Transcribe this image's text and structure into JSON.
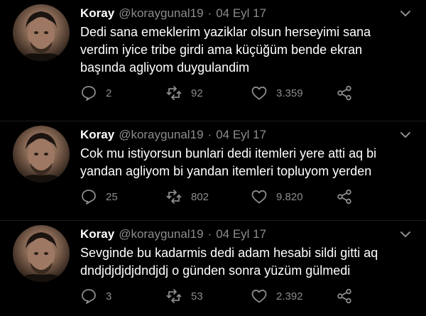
{
  "tweets": [
    {
      "name": "Koray",
      "handle": "@koraygunal19",
      "separator": "·",
      "date": "04 Eyl 17",
      "lines": [
        "Dedi sana emeklerim yaziklar olsun herseyimi sana",
        "verdim iyice tribe girdi ama küçüğüm bende ekran",
        "başında agliyom duygulandim"
      ],
      "replies": "2",
      "retweets": "92",
      "likes": "3.359"
    },
    {
      "name": "Koray",
      "handle": "@koraygunal19",
      "separator": "·",
      "date": "04 Eyl 17",
      "lines": [
        "Cok mu istiyorsun bunlari dedi itemleri yere atti aq bi",
        "yandan agliyom bi yandan itemleri topluyom yerden"
      ],
      "replies": "25",
      "retweets": "802",
      "likes": "9.820"
    },
    {
      "name": "Koray",
      "handle": "@koraygunal19",
      "separator": "·",
      "date": "04 Eyl 17",
      "lines": [
        "Sevginde bu kadarmis dedi adam hesabi sildi gitti aq",
        "dndjdjdjdjdndjdj o günden sonra yüzüm gülmedi"
      ],
      "replies": "3",
      "retweets": "53",
      "likes": "2.392"
    }
  ],
  "icons": {
    "reply": "reply-icon",
    "retweet": "retweet-icon",
    "like": "heart-icon",
    "share": "share-icon",
    "menu": "chevron-down-icon"
  },
  "colors": {
    "background": "#000000",
    "text": "#ffffff",
    "muted": "#8c8c8c"
  }
}
